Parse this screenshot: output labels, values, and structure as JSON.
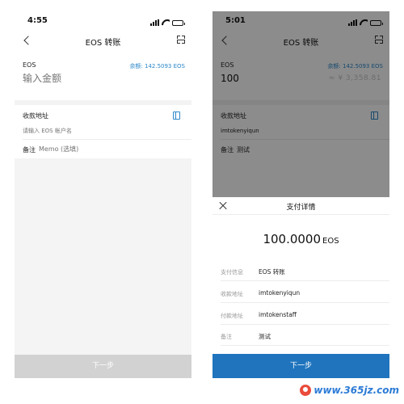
{
  "left": {
    "status": {
      "time": "4:55"
    },
    "nav": {
      "title": "EOS 转账"
    },
    "amount": {
      "token": "EOS",
      "balance": "余额: 142.5093 EOS",
      "placeholder": "输入金额"
    },
    "address": {
      "label": "收款地址",
      "placeholder": "请输入 EOS 帐户名"
    },
    "memo": {
      "label": "备注",
      "placeholder": "Memo (选填)"
    },
    "next_button": "下一步"
  },
  "right": {
    "status": {
      "time": "5:01"
    },
    "nav": {
      "title": "EOS 转账"
    },
    "amount": {
      "token": "EOS",
      "balance": "余额: 142.5093 EOS",
      "value": "100",
      "fiat": "≈ ¥ 3,358.81"
    },
    "address": {
      "label": "收款地址",
      "value": "imtokenyiqun"
    },
    "memo": {
      "label": "备注",
      "value": "测试"
    },
    "sheet": {
      "title": "支付详情",
      "amount": "100.0000",
      "unit": "EOS",
      "rows": [
        {
          "label": "支付信息",
          "value": "EOS 转账"
        },
        {
          "label": "收款地址",
          "value": "imtokenyiqun"
        },
        {
          "label": "付款地址",
          "value": "imtokenstaff"
        },
        {
          "label": "备注",
          "value": "测试"
        }
      ],
      "next_button": "下一步"
    }
  },
  "watermark": {
    "text": "www.365jz.com"
  },
  "colors": {
    "accent": "#1f74bd",
    "balance": "#2b87c9",
    "disabled": "#d2d2d2"
  },
  "icons": [
    "back-arrow-icon",
    "scan-icon",
    "address-book-icon",
    "close-icon",
    "signal-icon",
    "wifi-icon",
    "battery-icon"
  ]
}
